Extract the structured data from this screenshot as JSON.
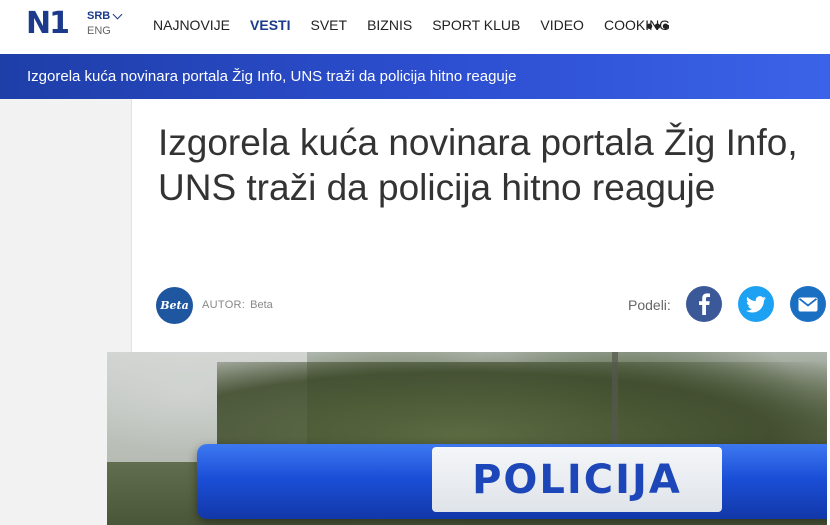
{
  "header": {
    "logo": "N1",
    "lang_primary": "SRB",
    "lang_secondary": "ENG",
    "nav": [
      {
        "label": "NAJNOVIJE",
        "active": false
      },
      {
        "label": "VESTI",
        "active": true
      },
      {
        "label": "SVET",
        "active": false
      },
      {
        "label": "BIZNIS",
        "active": false
      },
      {
        "label": "SPORT KLUB",
        "active": false
      },
      {
        "label": "VIDEO",
        "active": false
      },
      {
        "label": "COOKING",
        "active": false
      }
    ],
    "more_icon": "more-dots-icon"
  },
  "ticker": {
    "text": "Izgorela kuća novinara portala Žig Info, UNS traži da policija hitno reaguje"
  },
  "article": {
    "title": "Izgorela kuća novinara portala Žig Info, UNS traži da policija hitno reaguje",
    "avatar_text": "Beta",
    "author_label": "AUTOR:",
    "author_name": "Beta",
    "share_label": "Podeli:",
    "share_icons": [
      "facebook-icon",
      "twitter-icon",
      "email-icon"
    ],
    "image_text": "POLICIJA"
  },
  "colors": {
    "brand": "#1b3a8c",
    "ticker_start": "#1e3ea8",
    "ticker_end": "#3b63e8",
    "facebook": "#3b5998",
    "twitter": "#1da1f2",
    "email": "#1b6fc2"
  }
}
